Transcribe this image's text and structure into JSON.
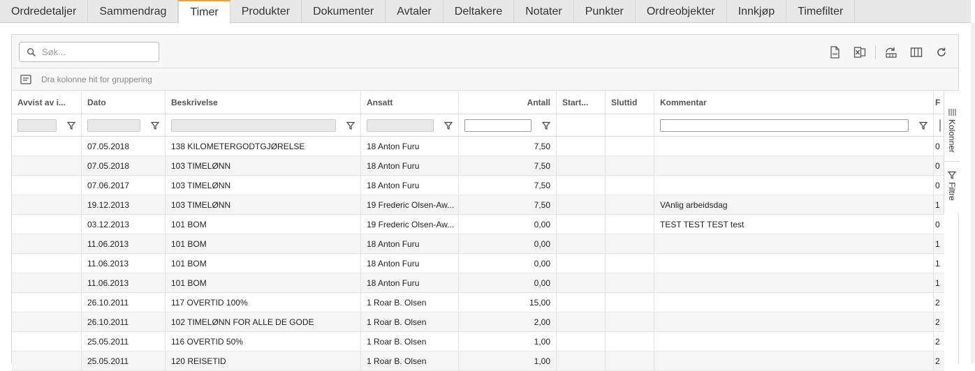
{
  "tabs": [
    {
      "label": "Ordredetaljer"
    },
    {
      "label": "Sammendrag"
    },
    {
      "label": "Timer",
      "active": true
    },
    {
      "label": "Produkter"
    },
    {
      "label": "Dokumenter"
    },
    {
      "label": "Avtaler"
    },
    {
      "label": "Deltakere"
    },
    {
      "label": "Notater"
    },
    {
      "label": "Punkter"
    },
    {
      "label": "Ordreobjekter"
    },
    {
      "label": "Innkjøp"
    },
    {
      "label": "Timefilter"
    }
  ],
  "search": {
    "placeholder": "Søk..."
  },
  "toolbar_icons": [
    "pdf-export-icon",
    "excel-export-icon",
    "reset-layout-icon",
    "columns-icon",
    "refresh-icon"
  ],
  "group_bar": {
    "text": "Dra kolonne hit for gruppering"
  },
  "columns": [
    "Avvist av i...",
    "Dato",
    "Beskrivelse",
    "Ansatt",
    "Antall",
    "Start...",
    "Sluttid",
    "Kommentar",
    "F"
  ],
  "rows": [
    {
      "avvist": "",
      "dato": "07.05.2018",
      "beskrivelse": "138 KILOMETERGODTGJØRELSE",
      "ansatt": "18 Anton Furu",
      "antall": "7,50",
      "start": "",
      "slutt": "",
      "kommentar": "",
      "last": "0"
    },
    {
      "avvist": "",
      "dato": "07.05.2018",
      "beskrivelse": "103 TIMELØNN",
      "ansatt": "18 Anton Furu",
      "antall": "7,50",
      "start": "",
      "slutt": "",
      "kommentar": "",
      "last": "0"
    },
    {
      "avvist": "",
      "dato": "07.06.2017",
      "beskrivelse": "103 TIMELØNN",
      "ansatt": "18 Anton Furu",
      "antall": "7,50",
      "start": "",
      "slutt": "",
      "kommentar": "",
      "last": "0"
    },
    {
      "avvist": "",
      "dato": "19.12.2013",
      "beskrivelse": "103 TIMELØNN",
      "ansatt": "19 Frederic Olsen-Aw...",
      "antall": "7,50",
      "start": "",
      "slutt": "",
      "kommentar": "VAnlig arbeidsdag",
      "last": "1"
    },
    {
      "avvist": "",
      "dato": "03.12.2013",
      "beskrivelse": "101 BOM",
      "ansatt": "19 Frederic Olsen-Aw...",
      "antall": "0,00",
      "start": "",
      "slutt": "",
      "kommentar": "TEST TEST TEST test",
      "last": "0"
    },
    {
      "avvist": "",
      "dato": "11.06.2013",
      "beskrivelse": "101 BOM",
      "ansatt": "18 Anton Furu",
      "antall": "0,00",
      "start": "",
      "slutt": "",
      "kommentar": "",
      "last": "1"
    },
    {
      "avvist": "",
      "dato": "11.06.2013",
      "beskrivelse": "101 BOM",
      "ansatt": "18 Anton Furu",
      "antall": "0,00",
      "start": "",
      "slutt": "",
      "kommentar": "",
      "last": "1"
    },
    {
      "avvist": "",
      "dato": "11.06.2013",
      "beskrivelse": "101 BOM",
      "ansatt": "18 Anton Furu",
      "antall": "0,00",
      "start": "",
      "slutt": "",
      "kommentar": "",
      "last": "1"
    },
    {
      "avvist": "",
      "dato": "26.10.2011",
      "beskrivelse": "117 OVERTID 100%",
      "ansatt": "1 Roar B. Olsen",
      "antall": "15,00",
      "start": "",
      "slutt": "",
      "kommentar": "",
      "last": "2"
    },
    {
      "avvist": "",
      "dato": "26.10.2011",
      "beskrivelse": "102 TIMELØNN FOR ALLE DE GODE",
      "ansatt": "1 Roar B. Olsen",
      "antall": "2,00",
      "start": "",
      "slutt": "",
      "kommentar": "",
      "last": "2"
    },
    {
      "avvist": "",
      "dato": "25.05.2011",
      "beskrivelse": "116 OVERTID 50%",
      "ansatt": "1 Roar B. Olsen",
      "antall": "1,00",
      "start": "",
      "slutt": "",
      "kommentar": "",
      "last": "2"
    },
    {
      "avvist": "",
      "dato": "25.05.2011",
      "beskrivelse": "120 REISETID",
      "ansatt": "1 Roar B. Olsen",
      "antall": "1,00",
      "start": "",
      "slutt": "",
      "kommentar": "",
      "last": "2"
    }
  ],
  "side_panel": {
    "columns_label": "Kolonner",
    "filters_label": "Filtre"
  }
}
